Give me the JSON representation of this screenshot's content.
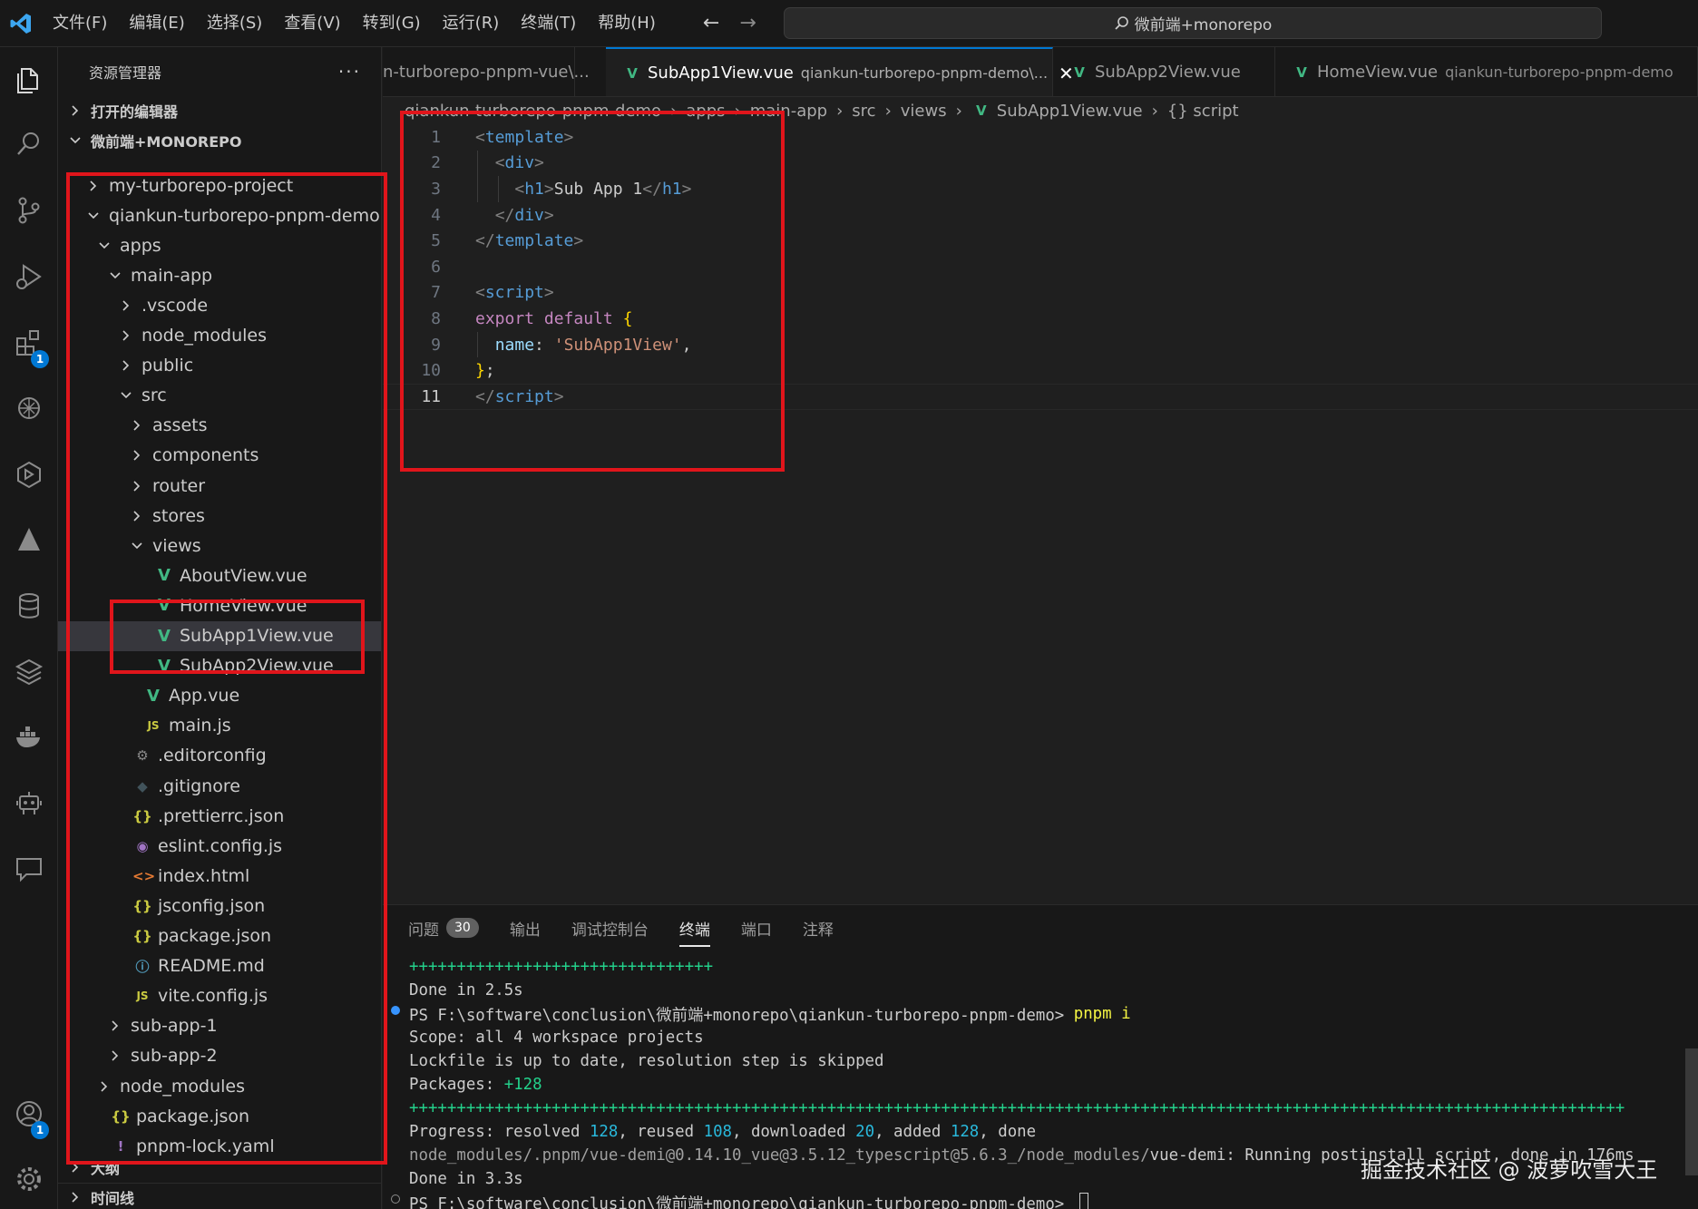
{
  "menu": [
    "文件(F)",
    "编辑(E)",
    "选择(S)",
    "查看(V)",
    "转到(G)",
    "运行(R)",
    "终端(T)",
    "帮助(H)"
  ],
  "nav": {
    "back": "←",
    "forward": "→"
  },
  "command_center": {
    "text": "微前端+monorepo"
  },
  "activity_badges": {
    "extensions": "1",
    "accounts": "1"
  },
  "sidebar": {
    "title": "资源管理器",
    "more": "···",
    "open_editors": "打开的编辑器",
    "workspace": "微前端+MONOREPO",
    "outline": "大纲",
    "timeline": "时间线",
    "tree": [
      {
        "label": "my-turborepo-project",
        "type": "folder"
      },
      {
        "label": "qiankun-turborepo-pnpm-demo",
        "type": "folder-open"
      },
      {
        "label": "apps",
        "type": "folder-open"
      },
      {
        "label": "main-app",
        "type": "folder-open"
      },
      {
        "label": ".vscode",
        "type": "folder"
      },
      {
        "label": "node_modules",
        "type": "folder"
      },
      {
        "label": "public",
        "type": "folder"
      },
      {
        "label": "src",
        "type": "folder-open"
      },
      {
        "label": "assets",
        "type": "folder"
      },
      {
        "label": "components",
        "type": "folder"
      },
      {
        "label": "router",
        "type": "folder"
      },
      {
        "label": "stores",
        "type": "folder"
      },
      {
        "label": "views",
        "type": "folder-open"
      },
      {
        "label": "AboutView.vue",
        "type": "vue"
      },
      {
        "label": "HomeView.vue",
        "type": "vue"
      },
      {
        "label": "SubApp1View.vue",
        "type": "vue"
      },
      {
        "label": "SubApp2View.vue",
        "type": "vue"
      },
      {
        "label": "App.vue",
        "type": "vue"
      },
      {
        "label": "main.js",
        "type": "js"
      },
      {
        "label": ".editorconfig",
        "type": "gear"
      },
      {
        "label": ".gitignore",
        "type": "git"
      },
      {
        "label": ".prettierrc.json",
        "type": "json"
      },
      {
        "label": "eslint.config.js",
        "type": "eslint"
      },
      {
        "label": "index.html",
        "type": "html"
      },
      {
        "label": "jsconfig.json",
        "type": "json"
      },
      {
        "label": "package.json",
        "type": "json"
      },
      {
        "label": "README.md",
        "type": "info"
      },
      {
        "label": "vite.config.js",
        "type": "js"
      },
      {
        "label": "sub-app-1",
        "type": "folder"
      },
      {
        "label": "sub-app-2",
        "type": "folder"
      },
      {
        "label": "node_modules",
        "type": "folder"
      },
      {
        "label": "package.json",
        "type": "json"
      },
      {
        "label": "pnpm-lock.yaml",
        "type": "yaml"
      }
    ],
    "icon_glyphs": {
      "js": "JS",
      "json": "{}",
      "info": "ⓘ",
      "html": "<>",
      "yaml": "!",
      "gear": "⚙",
      "git": "◆",
      "eslint": "◉"
    },
    "colors": {
      "vue": "#41b883",
      "js": "#cbcb41",
      "json": "#cbcb41",
      "info": "#519aba",
      "html": "#e37933",
      "yaml": "#a074c4",
      "gear": "#8b8b8b",
      "git": "#41535b",
      "eslint": "#a074c4"
    }
  },
  "tabs": [
    {
      "name": "n-turborepo-pnpm-vue\\...",
      "desc": ""
    },
    {
      "name": "SubApp1View.vue",
      "desc": "qiankun-turborepo-pnpm-demo\\...",
      "close": "✕"
    },
    {
      "name": "SubApp2View.vue",
      "desc": ""
    },
    {
      "name": "HomeView.vue",
      "desc": "qiankun-turborepo-pnpm-demo"
    }
  ],
  "breadcrumb": [
    "qiankun-turborepo-pnpm-demo",
    "apps",
    "main-app",
    "src",
    "views",
    "SubApp1View.vue",
    "{} script"
  ],
  "code": {
    "line_numbers": [
      "1",
      "2",
      "3",
      "4",
      "5",
      "6",
      "7",
      "8",
      "9",
      "10",
      "11"
    ],
    "current_line": 11
  },
  "panel": {
    "tabs": [
      "问题",
      "输出",
      "调试控制台",
      "终端",
      "端口",
      "注释"
    ],
    "problems_count": "30",
    "terminal": [
      "++++++++++++++++++++++++++++++++",
      "Done in 2.5s",
      "PS F:\\software\\conclusion\\微前端+monorepo\\qiankun-turborepo-pnpm-demo> ",
      "pnpm i",
      "Scope: all 4 workspace projects",
      "Lockfile is up to date, resolution step is skipped",
      "Packages: ",
      "+128",
      "++++++++++++++++++++++++++++++++++++++++++++++++++++++++++++++++++++++++++++++++++++++++++++++++++++++++++++++++++++++++++++++++",
      "Progress: resolved ",
      "128",
      ", reused ",
      "108",
      ", downloaded ",
      "20",
      ", added ",
      "128",
      ", done",
      "node_modules/.pnpm/vue-demi@0.14.10_vue@3.5.12_typescript@5.6.3_/node_modules/",
      "vue-demi: Running postinstall script, done in 176ms",
      "Done in 3.3s",
      "PS F:\\software\\conclusion\\微前端+monorepo\\qiankun-turborepo-pnpm-demo> "
    ]
  },
  "watermark": "掘金技术社区 @ 波萝吹雪大王"
}
